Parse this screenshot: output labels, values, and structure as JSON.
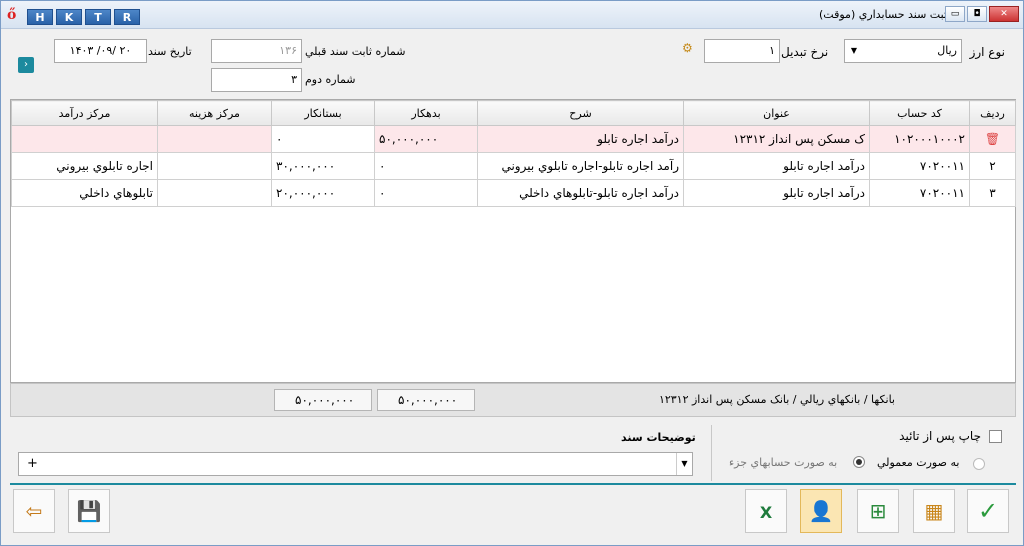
{
  "window": {
    "title": "ثبت سند حسابداري (موقت)",
    "hotkeys": [
      "H",
      "K",
      "T",
      "R"
    ],
    "logo_glyph": "ő"
  },
  "header": {
    "currency_type_label": "نوع ارز",
    "currency_value": "ريال",
    "exchange_rate_label": "نرخ تبديل",
    "exchange_rate_value": "۱",
    "prev_fixed_number_label": "شماره ثابت سند قبلي",
    "prev_fixed_number_value": "۱۳۶",
    "second_number_label": "شماره دوم",
    "second_number_value": "۳",
    "doc_date_label": "تاريخ سند",
    "doc_date_value": "۱۴۰۳ /۰۹/ ۲۰"
  },
  "grid": {
    "columns": [
      "رديف",
      "کد حساب",
      "عنوان",
      "شرح",
      "بدهکار",
      "بستانکار",
      "مرکز هزينه",
      "مرکز درآمد"
    ],
    "rows": [
      {
        "row": "",
        "code": "۱۰۲۰۰۰۱۰۰۰۲",
        "title": "ک مسکن پس انداز ۱۲۳۱۲",
        "desc": "درآمد اجاره تابلو",
        "debit": "۵۰,۰۰۰,۰۰۰",
        "credit": "۰",
        "cost_center": "",
        "income_center": ""
      },
      {
        "row": "۲",
        "code": "۷۰۲۰۰۱۱",
        "title": "درآمد اجاره تابلو",
        "desc": "رآمد اجاره تابلو-اجاره تابلوي بيروني",
        "debit": "۰",
        "credit": "۳۰,۰۰۰,۰۰۰",
        "cost_center": "",
        "income_center": "اجاره تابلوي بيروني"
      },
      {
        "row": "۳",
        "code": "۷۰۲۰۰۱۱",
        "title": "درآمد اجاره تابلو",
        "desc": "درآمد اجاره تابلو-تابلوهاي داخلي",
        "debit": "۰",
        "credit": "۲۰,۰۰۰,۰۰۰",
        "cost_center": "",
        "income_center": "تابلوهاي داخلي"
      }
    ]
  },
  "status": {
    "account_path": "بانکها / بانکهاي ريالي / بانک مسکن پس انداز ۱۲۳۱۲",
    "total_debit": "۵۰,۰۰۰,۰۰۰",
    "total_credit": "۵۰,۰۰۰,۰۰۰"
  },
  "options": {
    "print_after_confirm_label": "چاپ پس از تائيد",
    "radio_normal_label": "به صورت معمولي",
    "radio_partial_label": "به صورت حسابهاي جزء",
    "doc_description_label": "توضيحات سند",
    "doc_description_value": "+"
  },
  "colors": {
    "accent": "#1c8a9e",
    "selected_row": "#fde7ea",
    "highlight_button": "#fbe6b3"
  }
}
